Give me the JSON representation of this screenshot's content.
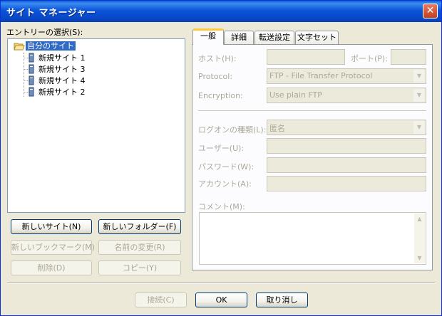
{
  "window": {
    "title": "サイト マネージャー"
  },
  "entry_label": "エントリーの選択(S):",
  "tree": {
    "root": "自分のサイト",
    "children": [
      "新規サイト 1",
      "新規サイト 3",
      "新規サイト 4",
      "新規サイト 2"
    ]
  },
  "left_buttons": {
    "new_site": "新しいサイト(N)",
    "new_folder": "新しいフォルダー(F)",
    "new_bookmark": "新しいブックマーク(M)",
    "rename": "名前の変更(R)",
    "delete": "削除(D)",
    "copy": "コピー(Y)"
  },
  "tabs": [
    "一般",
    "詳細",
    "転送設定",
    "文字セット"
  ],
  "general": {
    "host_label": "ホスト(H):",
    "port_label": "ポート(P):",
    "protocol_label": "Protocol:",
    "protocol_value": "FTP - File Transfer Protocol",
    "encryption_label": "Encryption:",
    "encryption_value": "Use plain FTP",
    "logon_type_label": "ログオンの種類(L):",
    "logon_type_value": "匿名",
    "user_label": "ユーザー(U):",
    "password_label": "パスワード(W):",
    "account_label": "アカウント(A):",
    "comment_label": "コメント(M):"
  },
  "bottom_buttons": {
    "connect": "接続(C)",
    "ok": "OK",
    "cancel": "取り消し"
  }
}
